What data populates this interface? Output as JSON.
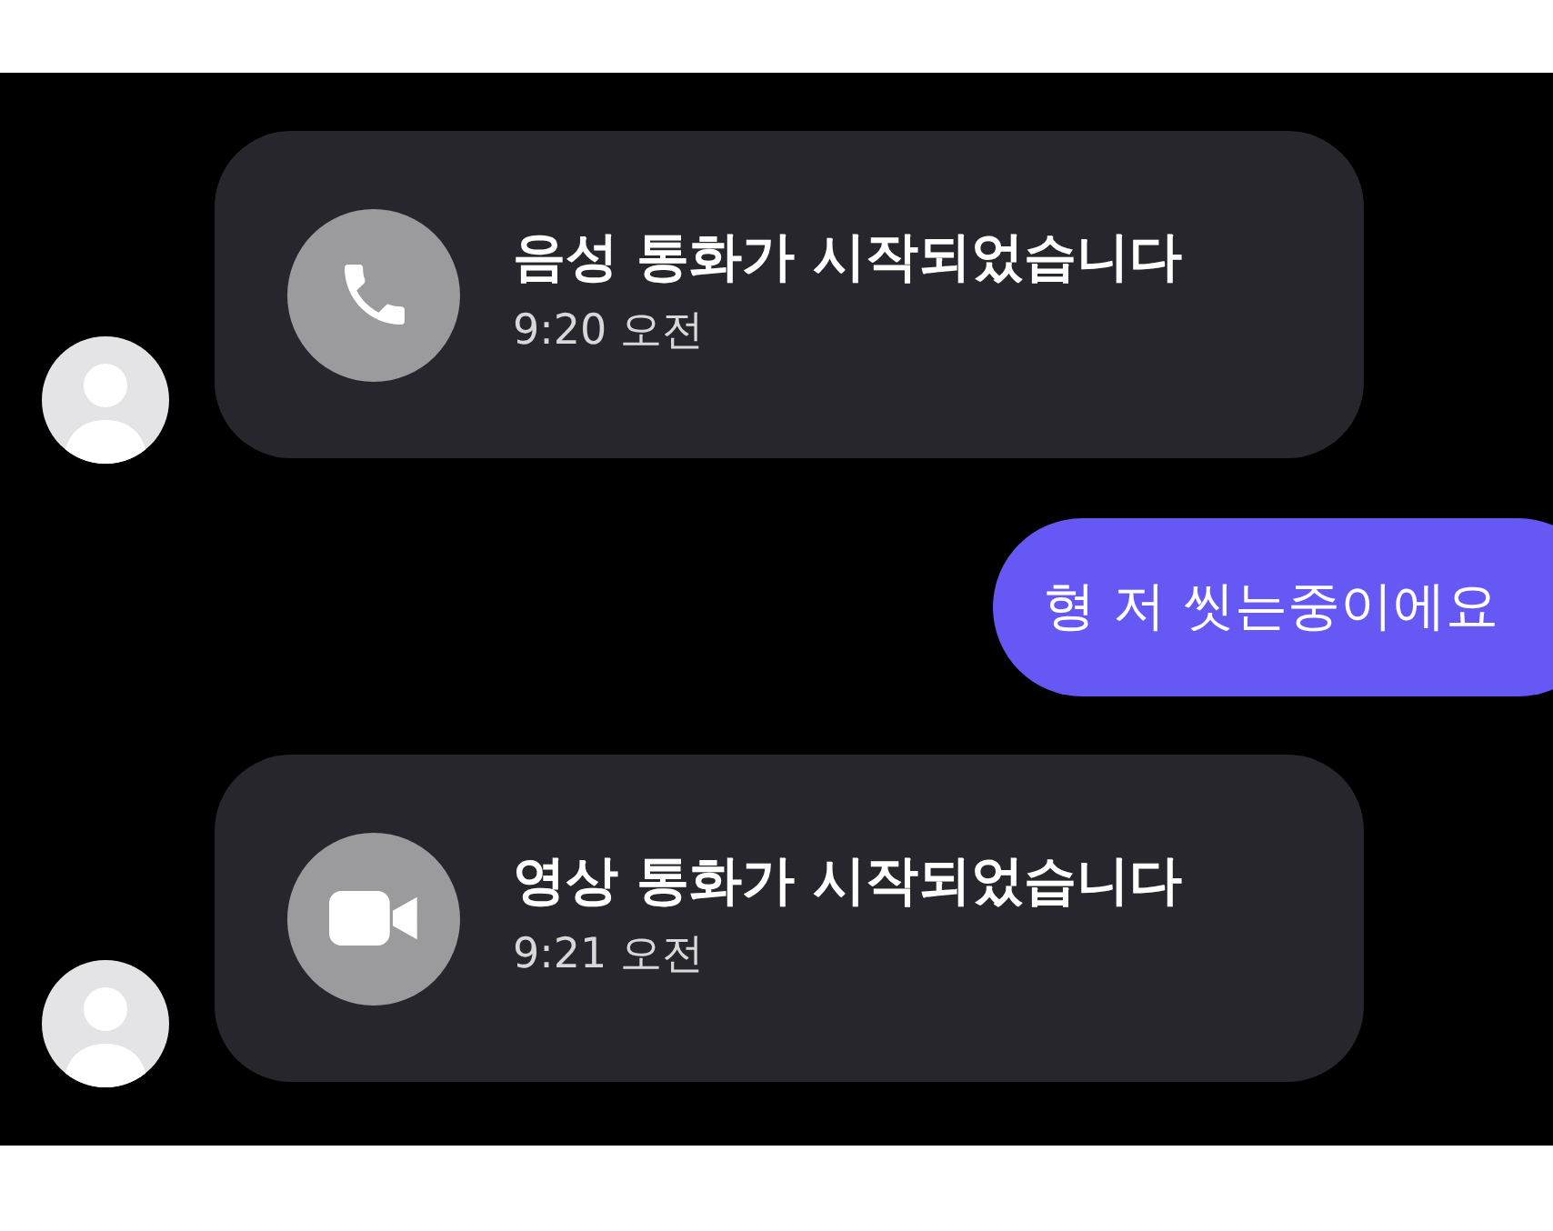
{
  "messages": [
    {
      "kind": "voice_call",
      "title": "음성 통화가 시작되었습니다",
      "time": "9:20 오전"
    },
    {
      "kind": "text",
      "text": "형 저 씻는중이에요"
    },
    {
      "kind": "video_call",
      "title": "영상 통화가 시작되었습니다",
      "time": "9:21 오전"
    }
  ]
}
